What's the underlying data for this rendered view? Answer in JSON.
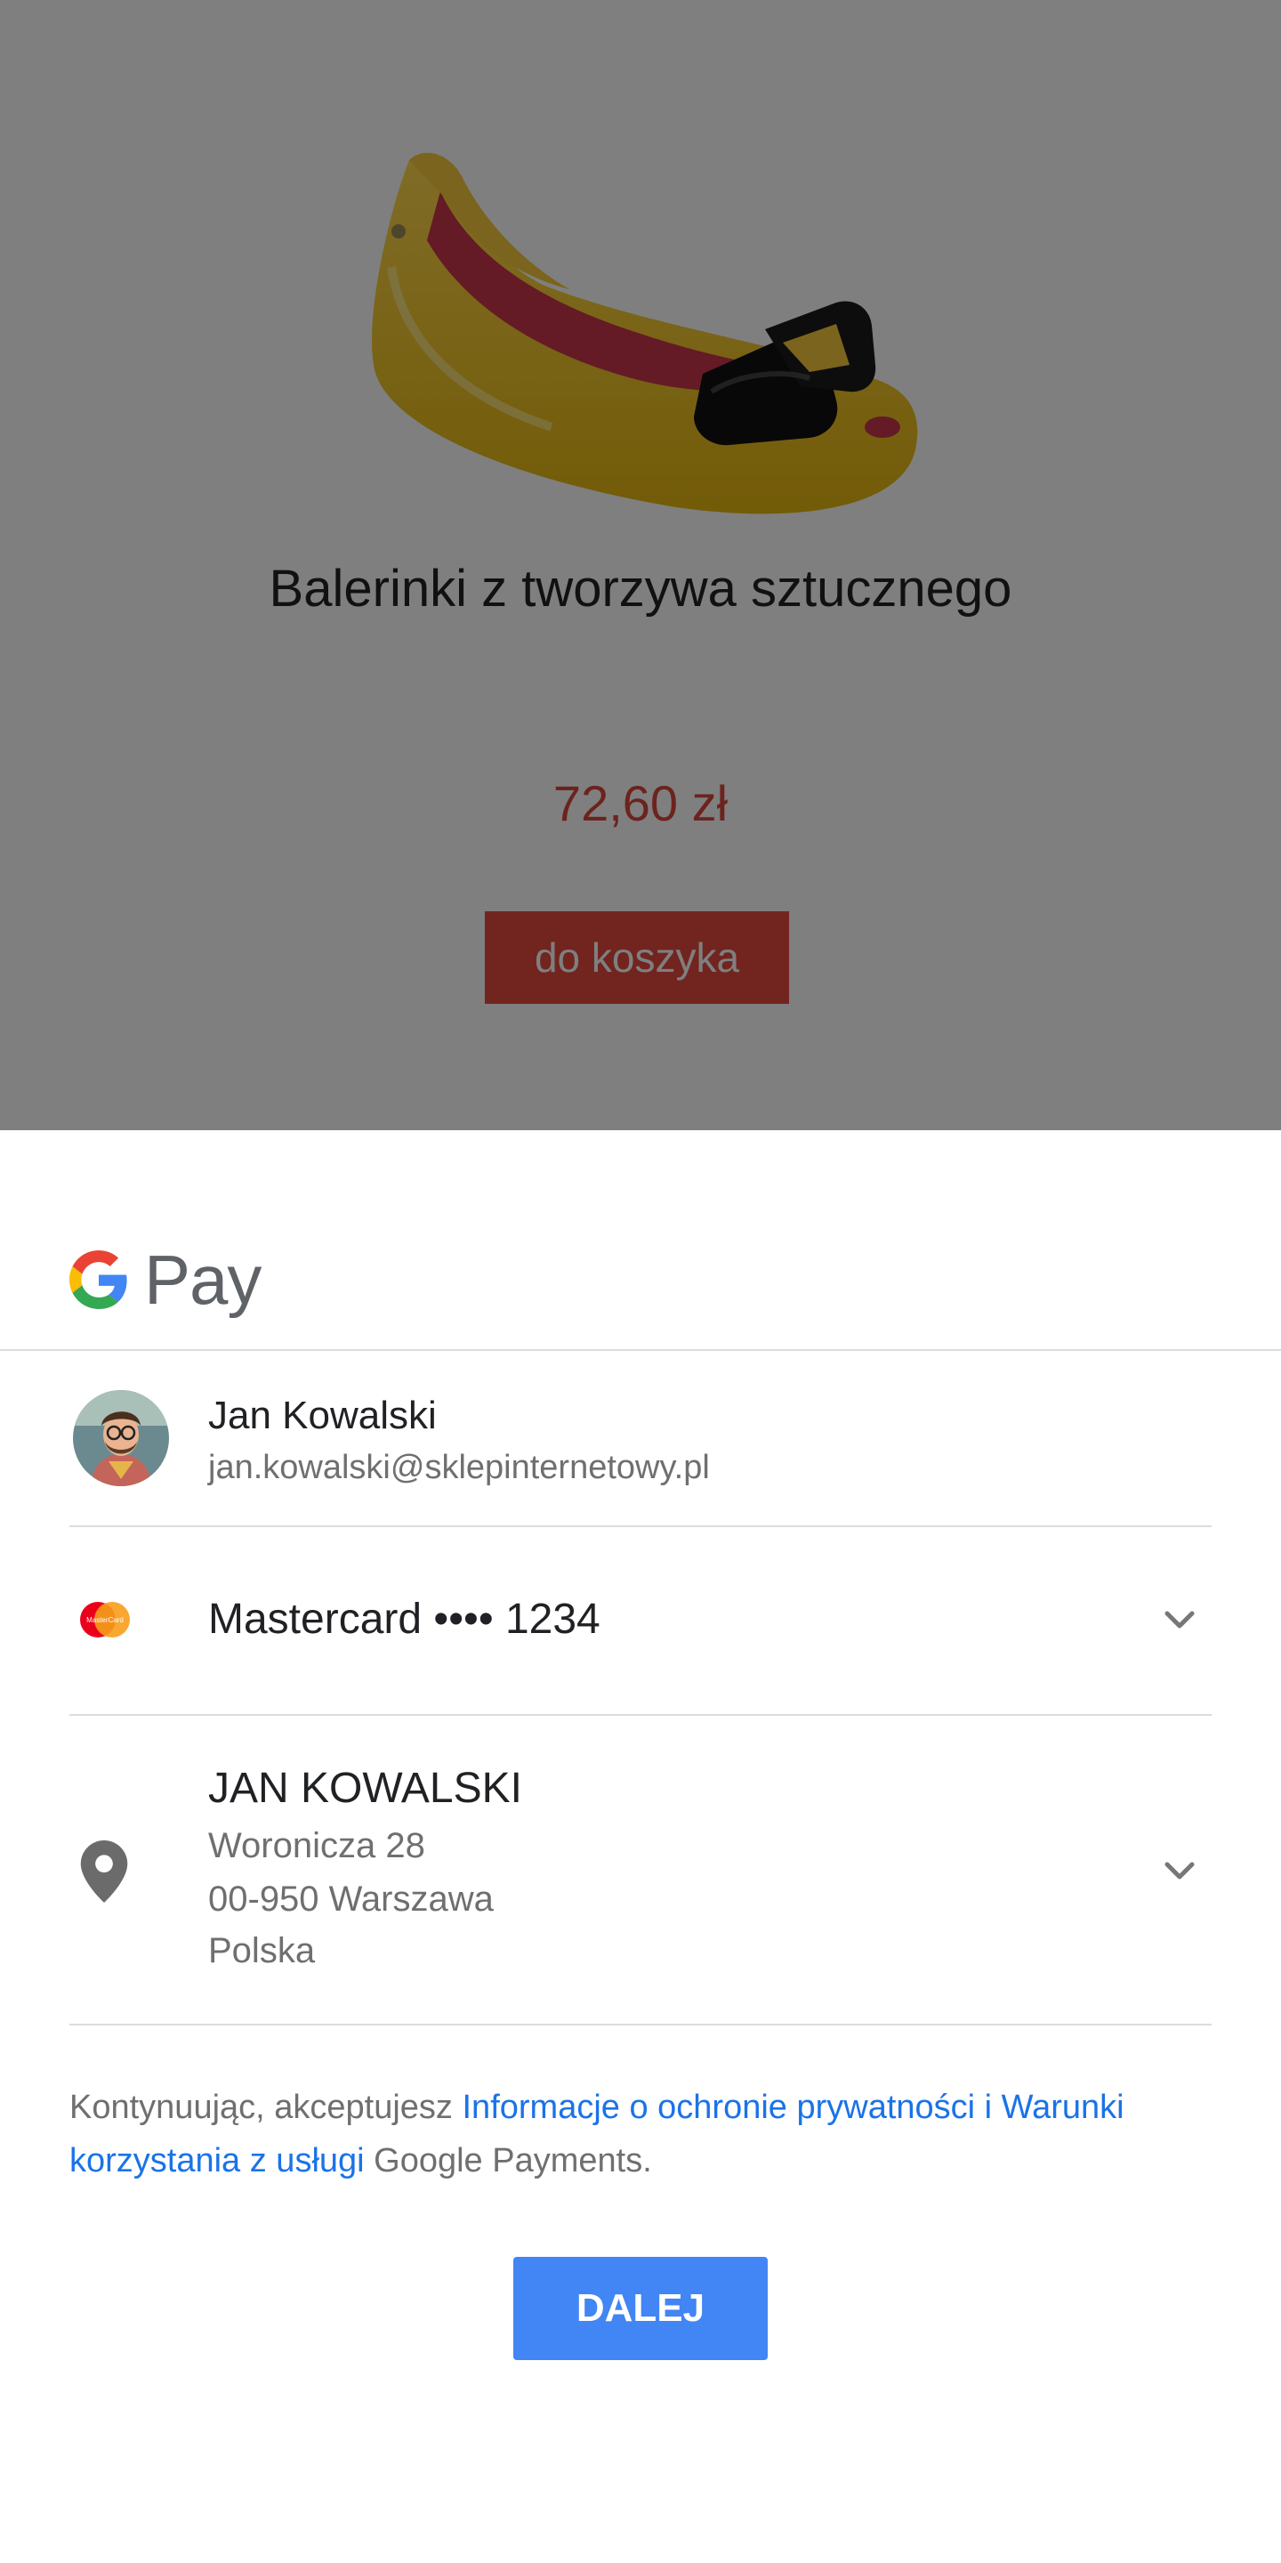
{
  "product": {
    "title": "Balerinki z tworzywa sztucznego",
    "price": "72,60 zł",
    "add_to_cart_label": "do koszyka"
  },
  "gpay": {
    "logo_text": "Pay",
    "logo_letter": "G"
  },
  "account": {
    "name": "Jan Kowalski",
    "email": "jan.kowalski@sklepinternetowy.pl"
  },
  "payment_method": {
    "label": "Mastercard •••• 1234",
    "icon": "mastercard-icon",
    "logo_text": "MasterCard"
  },
  "shipping_address": {
    "name": "JAN KOWALSKI",
    "line1": "Woronicza 28",
    "line2": "00-950 Warszawa",
    "country": "Polska"
  },
  "terms": {
    "prefix": "Kontynuując, akceptujesz ",
    "privacy_link": "Informacje o ochronie prywatności",
    "connector": " i ",
    "terms_link": "Warunki korzystania z usługi",
    "suffix": " Google Payments."
  },
  "continue_button_label": "DALEJ",
  "colors": {
    "accent_blue": "#4285f4",
    "link_blue": "#1a73e8",
    "price_red": "#d9463c",
    "cart_button_red": "#e4493f"
  }
}
